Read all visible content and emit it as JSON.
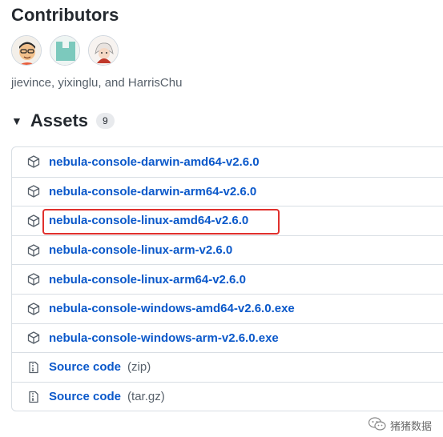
{
  "contributors": {
    "title": "Contributors",
    "avatars": [
      "jievince",
      "yixinglu",
      "HarrisChu"
    ],
    "names": "jievince, yixinglu, and HarrisChu"
  },
  "assets": {
    "title": "Assets",
    "count": "9",
    "items": [
      {
        "name": "nebula-console-darwin-amd64-v2.6.0",
        "icon": "package-icon"
      },
      {
        "name": "nebula-console-darwin-arm64-v2.6.0",
        "icon": "package-icon"
      },
      {
        "name": "nebula-console-linux-amd64-v2.6.0",
        "icon": "package-icon",
        "highlighted": true
      },
      {
        "name": "nebula-console-linux-arm-v2.6.0",
        "icon": "package-icon"
      },
      {
        "name": "nebula-console-linux-arm64-v2.6.0",
        "icon": "package-icon"
      },
      {
        "name": "nebula-console-windows-amd64-v2.6.0.exe",
        "icon": "package-icon"
      },
      {
        "name": "nebula-console-windows-arm-v2.6.0.exe",
        "icon": "package-icon"
      },
      {
        "name": "Source code",
        "ext": "(zip)",
        "icon": "file-zip-icon"
      },
      {
        "name": "Source code",
        "ext": "(tar.gz)",
        "icon": "file-zip-icon"
      }
    ]
  },
  "watermark": {
    "text": "猪猪数据",
    "icon": "wechat-icon"
  },
  "colors": {
    "link": "#0a58ca",
    "highlight": "#e0302d",
    "muted": "#57606a"
  }
}
